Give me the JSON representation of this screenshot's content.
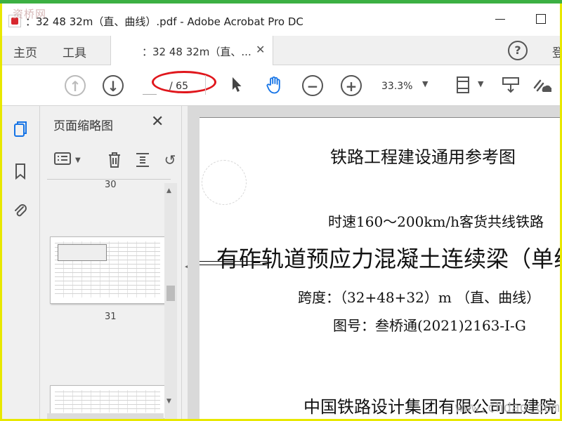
{
  "window": {
    "title": "：32 48 32m（直、曲线）.pdf - Adobe Acrobat Pro DC",
    "watermark_top": "资桥网",
    "watermark_bottom": "www.chdao.com"
  },
  "menu": {
    "home": "主页",
    "tools": "工具",
    "doc_tab": "：32 48 32m（直、...",
    "sign_in": "登"
  },
  "toolbar": {
    "page_current": "",
    "page_total": "/ 65",
    "zoom": "33.3%"
  },
  "panel": {
    "title": "页面缩略图",
    "thumbnails": [
      {
        "label": "30"
      },
      {
        "label": "31"
      }
    ]
  },
  "document": {
    "line1": "铁路工程建设通用参考图",
    "line2": "时速160～200km/h客货共线铁路",
    "line3": "有砟轨道预应力混凝土连续梁（单线",
    "line4": "跨度：（32+48+32）m （直、曲线）",
    "line5": "图号：叁桥通(2021)2163-Ⅰ-G",
    "line6": "中国铁路设计集团有限公司土建院"
  }
}
